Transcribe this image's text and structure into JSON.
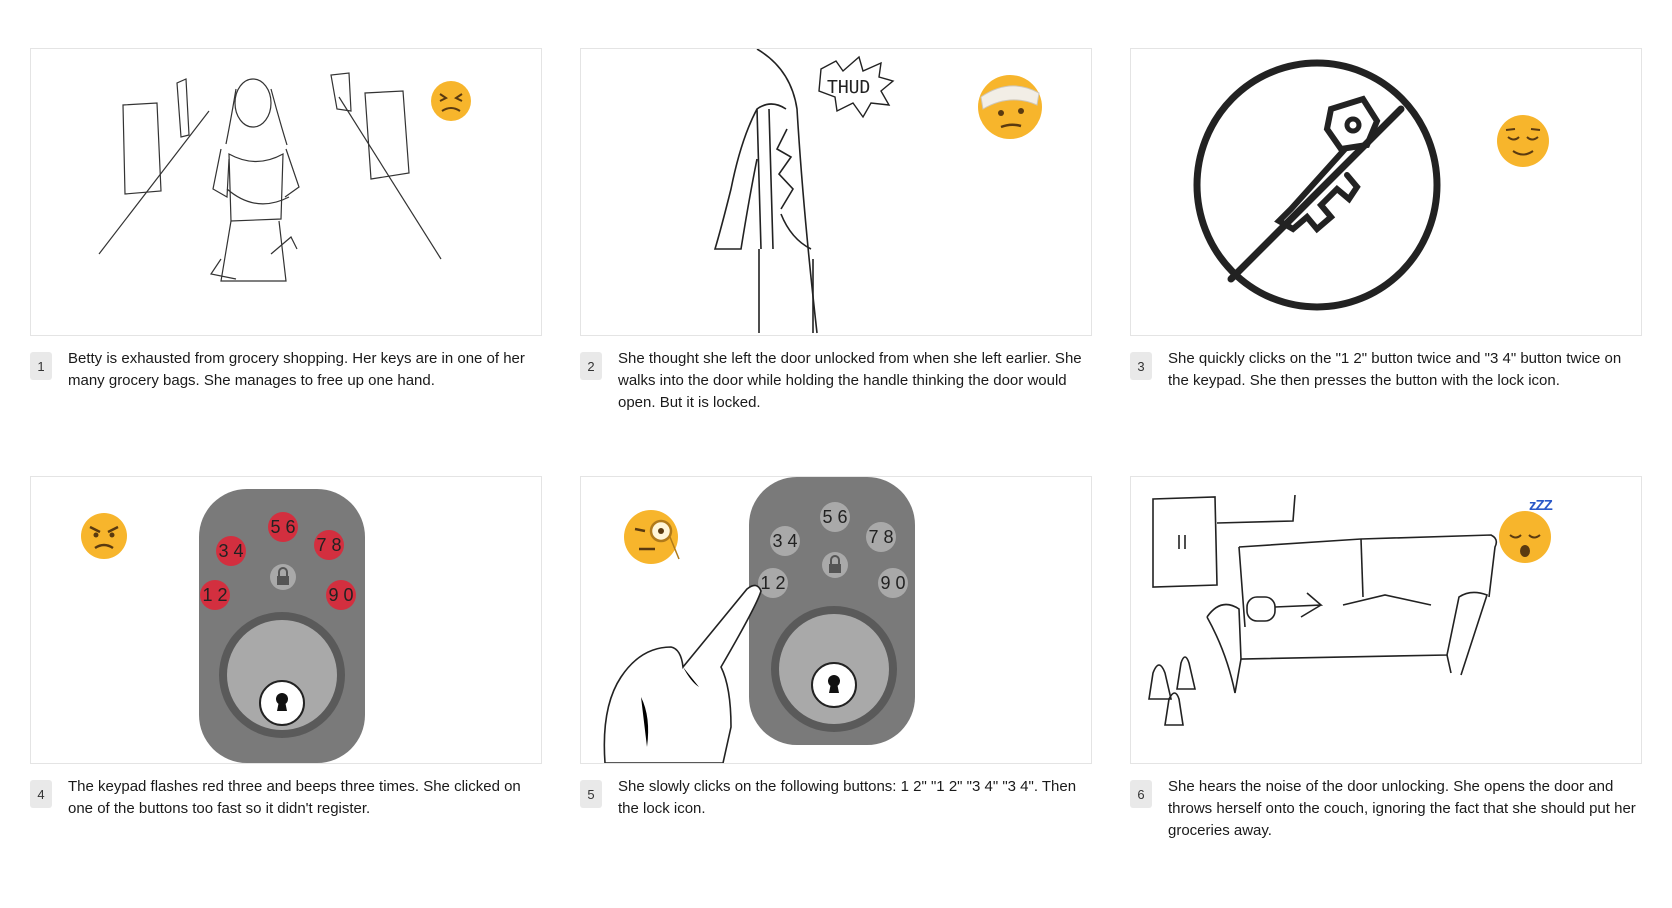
{
  "panels": [
    {
      "number": "1",
      "caption": "Betty is exhausted from grocery shopping. Her keys are in one of her many grocery bags. She manages to free up one hand.",
      "emoji": "tired-face-emoji"
    },
    {
      "number": "2",
      "caption": "She thought she left the door unlocked from when she left earlier. She walks into the door while holding the handle thinking the door would open. But it is locked.",
      "sound_effect": "THUD",
      "emoji": "bandaged-head-emoji"
    },
    {
      "number": "3",
      "caption": "She quickly clicks on the \"1 2\" button twice and \"3 4\" button twice on the keypad. She then presses the button with the lock icon.",
      "emoji": "relieved-face-emoji"
    },
    {
      "number": "4",
      "caption": "The keypad flashes red three and beeps three times. She clicked on one of the buttons too fast so it didn't register.",
      "keys": [
        "1 2",
        "3 4",
        "5 6",
        "7 8",
        "9 0"
      ],
      "emoji": "angry-face-emoji"
    },
    {
      "number": "5",
      "caption": "She slowly clicks on the following buttons: 1 2\" \"1 2\" \"3 4\" \"3 4\". Then the lock icon.",
      "keys": [
        "1 2",
        "3 4",
        "5 6",
        "7 8",
        "9 0"
      ],
      "emoji": "monocle-face-emoji"
    },
    {
      "number": "6",
      "caption": "She hears the noise of the door unlocking. She opens the door and throws herself onto the couch, ignoring the fact that she should put her groceries away.",
      "emoji": "sleeping-face-emoji",
      "zzz": "zZZ"
    }
  ],
  "colors": {
    "keypad_body": "#7a7a7a",
    "key_gray": "#a9a9a9",
    "key_red": "#d32f3f",
    "emoji_yellow": "#f7b52c",
    "frame_border": "#e4e4e4"
  }
}
